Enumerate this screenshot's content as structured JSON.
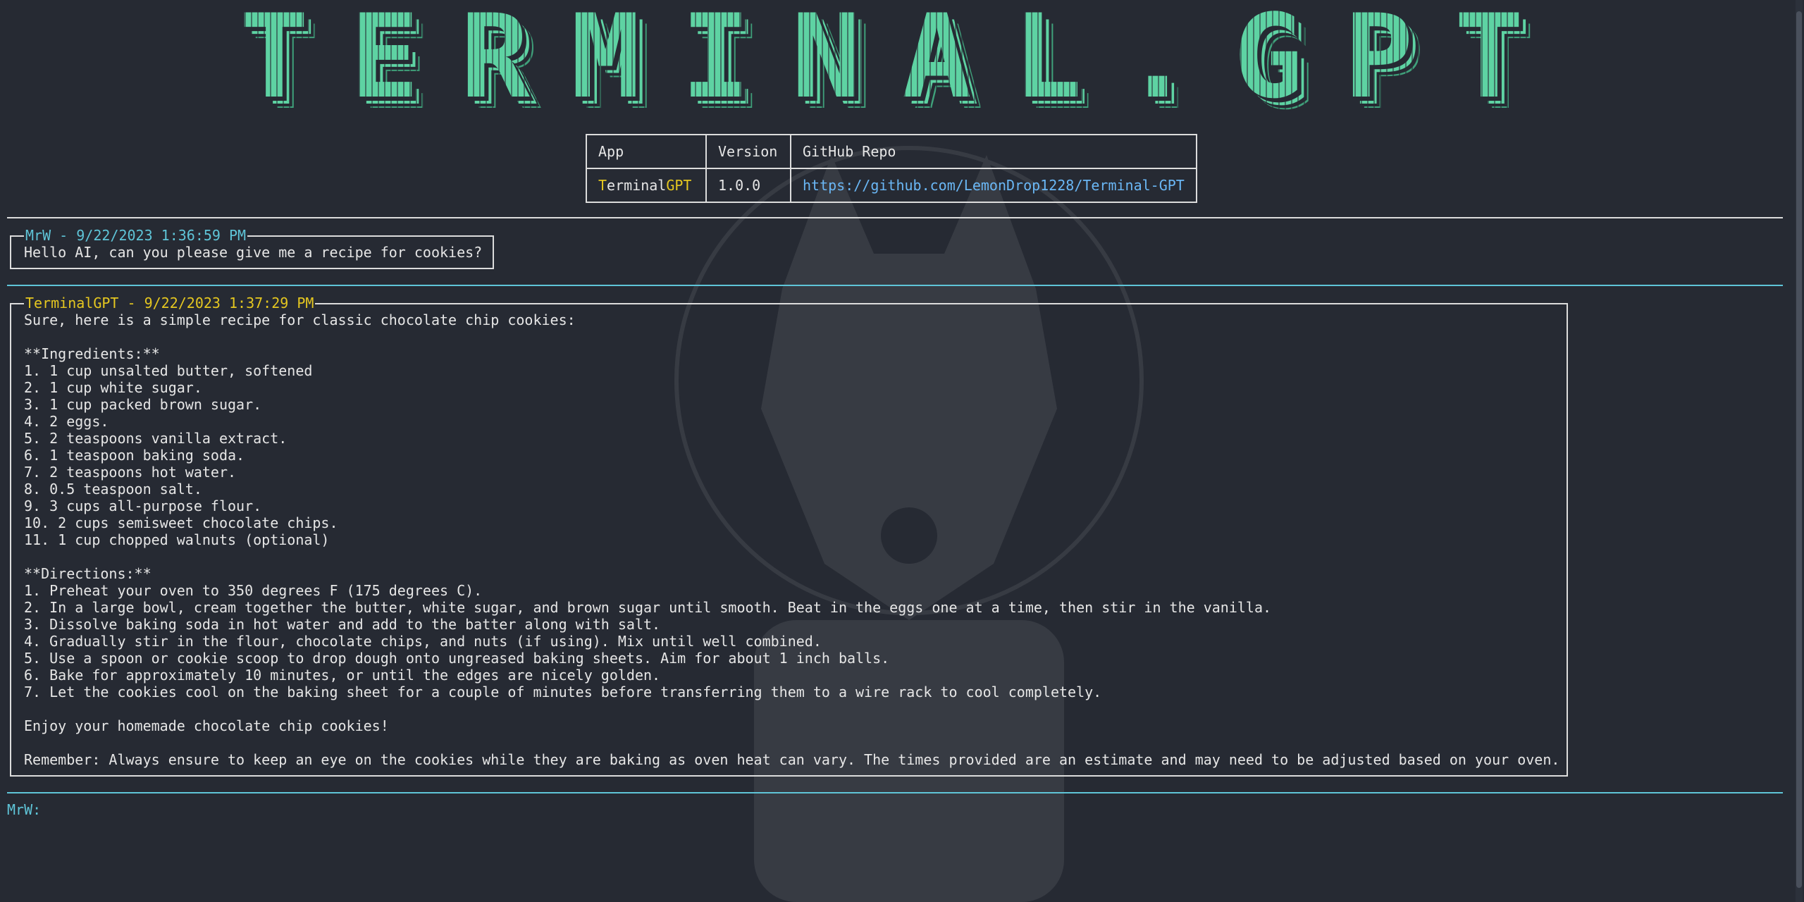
{
  "banner": {
    "title": "TERMINAL.GPT"
  },
  "info_table": {
    "headers": [
      "App",
      "Version",
      "GitHub Repo"
    ],
    "app_name_first": "T",
    "app_name_middle": "erminal",
    "app_name_last": "GPT",
    "version": "1.0.0",
    "repo_url": "https://github.com/LemonDrop1228/Terminal-GPT"
  },
  "messages": [
    {
      "header": "MrW - 9/22/2023 1:36:59 PM",
      "lines": [
        "Hello AI, can you please give me a recipe for cookies?"
      ]
    },
    {
      "header": "TerminalGPT - 9/22/2023 1:37:29 PM",
      "lines": [
        "Sure, here is a simple recipe for classic chocolate chip cookies:",
        "",
        "**Ingredients:**",
        "1. 1 cup unsalted butter, softened",
        "2. 1 cup white sugar.",
        "3. 1 cup packed brown sugar.",
        "4. 2 eggs.",
        "5. 2 teaspoons vanilla extract.",
        "6. 1 teaspoon baking soda.",
        "7. 2 teaspoons hot water.",
        "8. 0.5 teaspoon salt.",
        "9. 3 cups all-purpose flour.",
        "10. 2 cups semisweet chocolate chips.",
        "11. 1 cup chopped walnuts (optional)",
        "",
        "**Directions:**",
        "1. Preheat your oven to 350 degrees F (175 degrees C).",
        "2. In a large bowl, cream together the butter, white sugar, and brown sugar until smooth. Beat in the eggs one at a time, then stir in the vanilla.",
        "3. Dissolve baking soda in hot water and add to the batter along with salt.",
        "4. Gradually stir in the flour, chocolate chips, and nuts (if using). Mix until well combined.",
        "5. Use a spoon or cookie scoop to drop dough onto ungreased baking sheets. Aim for about 1 inch balls.",
        "6. Bake for approximately 10 minutes, or until the edges are nicely golden.",
        "7. Let the cookies cool on the baking sheet for a couple of minutes before transferring them to a wire rack to cool completely.",
        "",
        "Enjoy your homemade chocolate chip cookies!",
        "",
        "Remember: Always ensure to keep an eye on the cookies while they are baking as oven heat can vary. The times provided are an estimate and may need to be adjusted based on your oven."
      ]
    }
  ],
  "prompt": {
    "label": "MrW:",
    "value": ""
  },
  "colors": {
    "background": "#262a33",
    "banner": "#5ed3a3",
    "user_header": "#5fc5d8",
    "ai_header": "#e5c720",
    "version": "#f07b7b",
    "link": "#6ab7f5"
  }
}
